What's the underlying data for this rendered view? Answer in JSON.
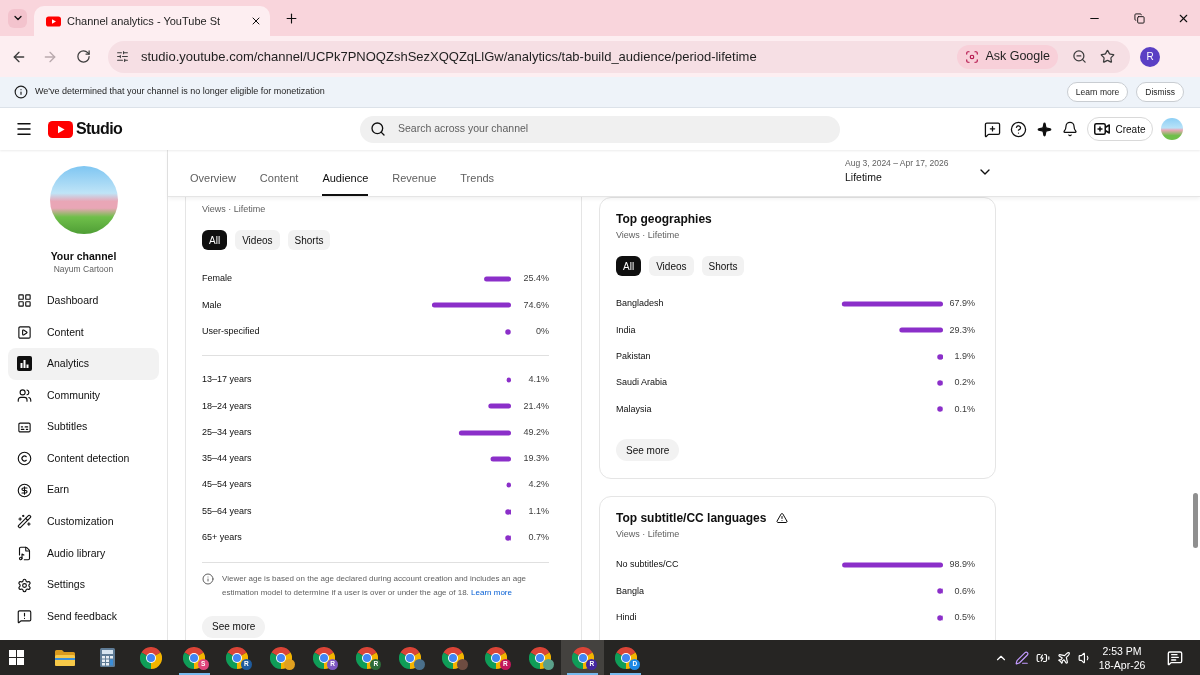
{
  "browser": {
    "tab_title": "Channel analytics - YouTube St",
    "back_disabled": false,
    "forward_disabled": true,
    "url": "studio.youtube.com/channel/UCPk7PNOQZshSezXQQZqLlGw/analytics/tab-build_audience/period-lifetime",
    "ask_google": "Ask Google",
    "profile_initial": "R"
  },
  "notice": {
    "text": "We've determined that your channel is no longer eligible for monetization",
    "buttons": [
      "Learn more",
      "Dismiss"
    ]
  },
  "header": {
    "logo": "Studio",
    "search": {
      "placeholder": "Search across your channel"
    },
    "create": "Create"
  },
  "sidebar": {
    "channel_label": "Your channel",
    "channel_name": "Nayum Cartoon",
    "items": [
      {
        "label": "Dashboard",
        "selected": false
      },
      {
        "label": "Content",
        "selected": false
      },
      {
        "label": "Analytics",
        "selected": true
      },
      {
        "label": "Community",
        "selected": false
      },
      {
        "label": "Subtitles",
        "selected": false
      },
      {
        "label": "Content detection",
        "selected": false
      },
      {
        "label": "Earn",
        "selected": false
      },
      {
        "label": "Customization",
        "selected": false
      },
      {
        "label": "Audio library",
        "selected": false
      },
      {
        "label": "Settings",
        "selected": false
      },
      {
        "label": "Send feedback",
        "selected": false
      }
    ]
  },
  "tabs": [
    {
      "label": "Overview",
      "selected": false
    },
    {
      "label": "Content",
      "selected": false
    },
    {
      "label": "Audience",
      "selected": true
    },
    {
      "label": "Revenue",
      "selected": false
    },
    {
      "label": "Trends",
      "selected": false
    }
  ],
  "date_range": {
    "range": "Aug 3, 2024 – Apr 17, 2026",
    "period": "Lifetime"
  },
  "age_gender": {
    "subtitle": "Views · Lifetime",
    "filters": [
      {
        "label": "All",
        "selected": true
      },
      {
        "label": "Videos",
        "selected": false
      },
      {
        "label": "Shorts",
        "selected": false
      }
    ],
    "gender": {
      "chart_data": {
        "type": "bar",
        "orientation": "horizontal",
        "categories": [
          "Female",
          "Male",
          "User-specified"
        ],
        "values": [
          25.4,
          74.6,
          0
        ],
        "value_labels": [
          "25.4%",
          "74.6%",
          "0%"
        ]
      }
    },
    "age": {
      "chart_data": {
        "type": "bar",
        "orientation": "horizontal",
        "categories": [
          "13–17 years",
          "18–24 years",
          "25–34 years",
          "35–44 years",
          "45–54 years",
          "55–64 years",
          "65+ years"
        ],
        "values": [
          4.1,
          21.4,
          49.2,
          19.3,
          4.2,
          1.1,
          0.7
        ],
        "value_labels": [
          "4.1%",
          "21.4%",
          "49.2%",
          "19.3%",
          "4.2%",
          "1.1%",
          "0.7%"
        ]
      }
    },
    "note": {
      "text": "Viewer age is based on the age declared during account creation and includes an age estimation model to determine if a user is over or under the age of 18.",
      "link": "Learn more"
    },
    "see_more": "See more"
  },
  "top_geographies": {
    "title": "Top geographies",
    "subtitle": "Views · Lifetime",
    "filters": [
      {
        "label": "All",
        "selected": true
      },
      {
        "label": "Videos",
        "selected": false
      },
      {
        "label": "Shorts",
        "selected": false
      }
    ],
    "chart_data": {
      "type": "bar",
      "orientation": "horizontal",
      "categories": [
        "Bangladesh",
        "India",
        "Pakistan",
        "Saudi Arabia",
        "Malaysia"
      ],
      "values": [
        67.9,
        29.3,
        1.9,
        0.2,
        0.1
      ],
      "value_labels": [
        "67.9%",
        "29.3%",
        "1.9%",
        "0.2%",
        "0.1%"
      ]
    },
    "see_more": "See more"
  },
  "top_subtitle_languages": {
    "title": "Top subtitle/CC languages",
    "subtitle": "Views · Lifetime",
    "chart_data": {
      "type": "bar",
      "orientation": "horizontal",
      "categories": [
        "No subtitles/CC",
        "Bangla",
        "Hindi"
      ],
      "values": [
        98.9,
        0.6,
        0.5
      ],
      "value_labels": [
        "98.9%",
        "0.6%",
        "0.5%"
      ]
    }
  },
  "taskbar": {
    "apps": [
      {
        "kind": "start",
        "running": false,
        "selected": false
      },
      {
        "kind": "explorer",
        "running": false,
        "selected": false
      },
      {
        "kind": "calculator",
        "running": false,
        "selected": false
      },
      {
        "kind": "chrome",
        "running": false,
        "selected": false
      },
      {
        "kind": "chrome",
        "badge": "S",
        "color": "#e0457b",
        "running": true,
        "selected": false
      },
      {
        "kind": "chrome",
        "badge": "R",
        "color": "#1f5c9e",
        "running": false,
        "selected": false
      },
      {
        "kind": "chrome",
        "color": "#e0a020",
        "running": false,
        "selected": false
      },
      {
        "kind": "chrome",
        "badge": "R",
        "color": "#7e57c2",
        "running": false,
        "selected": false
      },
      {
        "kind": "chrome",
        "badge": "R",
        "color": "#2e6b3a",
        "running": false,
        "selected": false
      },
      {
        "kind": "chrome",
        "color": "#4a6f8a",
        "running": false,
        "selected": false
      },
      {
        "kind": "chrome",
        "color": "#6d4c41",
        "running": false,
        "selected": false
      },
      {
        "kind": "chrome",
        "badge": "R",
        "color": "#c2185b",
        "running": false,
        "selected": false
      },
      {
        "kind": "chrome",
        "color": "#5aa08a",
        "running": false,
        "selected": false
      },
      {
        "kind": "chrome",
        "badge": "R",
        "color": "#4527a0",
        "running": true,
        "selected": true
      },
      {
        "kind": "chrome",
        "badge": "D",
        "color": "#1e88e5",
        "running": true,
        "selected": false
      }
    ],
    "time": "2:53 PM",
    "date": "18-Apr-26"
  }
}
